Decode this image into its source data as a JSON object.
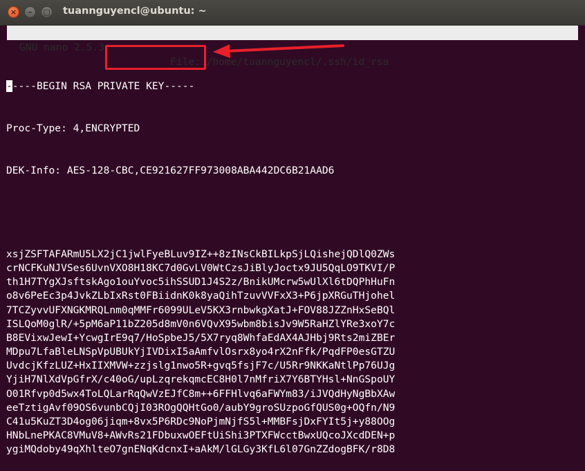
{
  "window": {
    "title": "tuannguyencl@ubuntu: ~",
    "buttons": {
      "close": "×",
      "minimize": "–",
      "maximize": "□"
    }
  },
  "nano": {
    "version": "GNU nano 2.5.3",
    "file": "File: /home/tuannguyencl/.ssh/id_rsa"
  },
  "content": {
    "begin_line": "-----BEGIN RSA PRIVATE KEY-----",
    "proc_type": "Proc-Type: 4,ENCRYPTED",
    "dek_info": "DEK-Info: AES-128-CBC,CE921627FF973008ABA442DC6B21AAD6",
    "key_lines": [
      "xsjZSFTAFARmU5LX2jC1jwlFyeBLuv9IZ++8zINsCkBILkpSjLQishejQDlQ0ZWs",
      "crNCFKuNJVSes6UvnVXO8H18KC7d0GvLV0WtCzsJiBlyJoctx9JU5QqLO9TKVI/P",
      "th1H7TYgXJsftskAgo1ouYvoc5ihSSUD1J4S2z/BnikUMcrw5wUlXl6tDQPhHuFn",
      "o8v6PeEc3p4JvkZLbIxRst0FBiidnK0k8yaQihTzuvVVFxX3+P6jpXRGuTHjohel",
      "7TCZyvvUFXNGKMRQLnm0qMMFr6099ULeV5KX3rnbwkgXatJ+FOV88JZZnHxSeBQl",
      "ISLQoM0glR/+5pM6aP11bZ205d8mV0n6VQvX95wbm8bisJv9W5RaHZlYRe3xoY7c",
      "B8EVixwJewI+YcwgIrE9q7/HoSpbeJ5/5X7ryq8WhfaEdAX4AJHbj9Rts2miZBEr",
      "MDpu7LfaBleLNSpVpUBUkYjIVDixI5aAmfvlOsrx8yo4rX2nFfk/PqdFP0esGTZU",
      "UvdcjKfzLUZ+HxIIXMVW+zzjslg1nwo5R+gvq5fsjF7c/U5Rr9NKKaNtlPp76UJg",
      "YjiH7NlXdVpGfrX/c40oG/upLzqrekqmcEC8H0l7nMfriX7Y6BTYHsl+NnGSpoUY",
      "O01Rfvp0d5wx4ToLQLarRqQwVzEJfC8m++6FFHlvq6aFWYm83/iJVQdHyNgBbXAw",
      "eeTztigAvf09OS6vunbCQjI03ROgQQHtGo0/aubY9groSUzpoGfQUS0g+OQfn/N9",
      "C41u5KuZT3D4og06jiqm+8vx5P6RDc9NoPjmNjfS5l+MMBFsjDxFYIt5j+y88OOg",
      "HNbLnePKAC8VMuV8+AWvRs21FDbuxwOEFtUiShi3PTXFWcctBwxUQcoJXcdDEN+p",
      "ygiMQdoby49qXhlteO7gnENqKdcnxI+aAkM/lGLGy3KfL6l07GnZZdogBFK/r8D8"
    ]
  }
}
